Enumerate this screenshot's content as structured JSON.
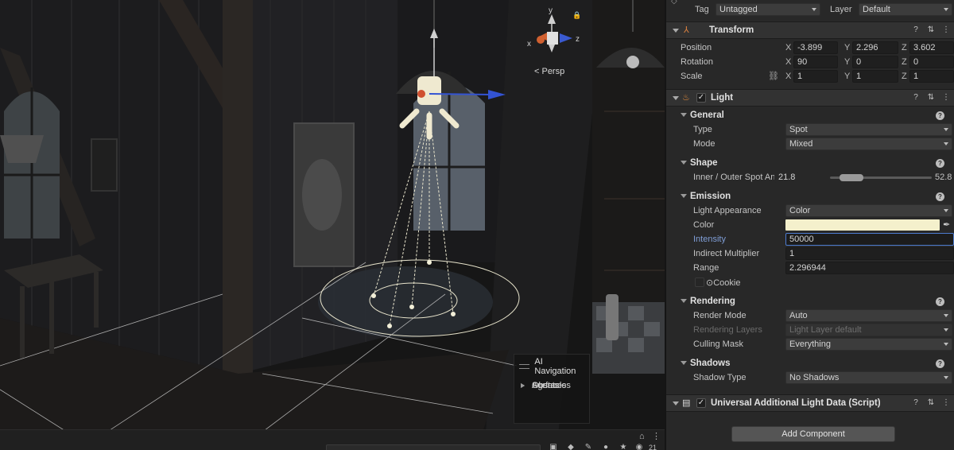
{
  "scene": {
    "view_mode": "< Persp",
    "gizmo_axes": {
      "x": "x",
      "y": "y",
      "z": "z"
    },
    "ai_navigation": {
      "title": "AI Navigation",
      "items": [
        "Surfaces",
        "Agents",
        "Obstacles"
      ]
    },
    "visible_count": "21"
  },
  "inspector": {
    "tag_label": "Tag",
    "tag_value": "Untagged",
    "layer_label": "Layer",
    "layer_value": "Default",
    "transform": {
      "title": "Transform",
      "position": {
        "label": "Position",
        "x": "-3.899",
        "y": "2.296",
        "z": "3.602"
      },
      "rotation": {
        "label": "Rotation",
        "x": "90",
        "y": "0",
        "z": "0"
      },
      "scale": {
        "label": "Scale",
        "x": "1",
        "y": "1",
        "z": "1"
      }
    },
    "light": {
      "title": "Light",
      "general": {
        "title": "General",
        "type_label": "Type",
        "type_value": "Spot",
        "mode_label": "Mode",
        "mode_value": "Mixed"
      },
      "shape": {
        "title": "Shape",
        "spot_label": "Inner / Outer Spot Ang",
        "inner_value": "21.8",
        "outer_value": "52.8"
      },
      "emission": {
        "title": "Emission",
        "appearance_label": "Light Appearance",
        "appearance_value": "Color",
        "color_label": "Color",
        "color_hex": "#f4f0cc",
        "intensity_label": "Intensity",
        "intensity_value": "50000",
        "indirect_label": "Indirect Multiplier",
        "indirect_value": "1",
        "range_label": "Range",
        "range_value": "2.296944",
        "cookie_label": "Cookie"
      },
      "rendering": {
        "title": "Rendering",
        "render_mode_label": "Render Mode",
        "render_mode_value": "Auto",
        "rendering_layers_label": "Rendering Layers",
        "rendering_layers_value": "Light Layer default",
        "culling_mask_label": "Culling Mask",
        "culling_mask_value": "Everything"
      },
      "shadows": {
        "title": "Shadows",
        "shadow_type_label": "Shadow Type",
        "shadow_type_value": "No Shadows"
      }
    },
    "additional_light": {
      "title": "Universal Additional Light Data (Script)"
    },
    "add_component_label": "Add Component"
  }
}
